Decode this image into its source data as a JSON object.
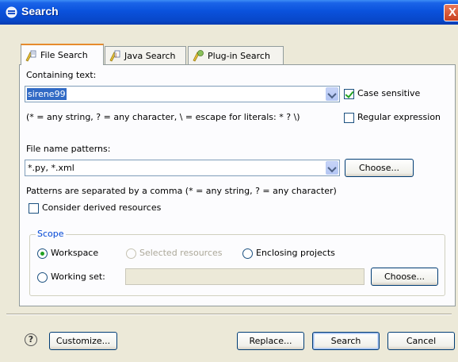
{
  "window": {
    "title": "Search",
    "close_glyph": "X"
  },
  "tabs": [
    {
      "label": "File Search",
      "active": true,
      "icon": "file-search-icon"
    },
    {
      "label": "Java Search",
      "active": false,
      "icon": "java-search-icon"
    },
    {
      "label": "Plug-in Search",
      "active": false,
      "icon": "plugin-search-icon"
    }
  ],
  "containing_text": {
    "label": "Containing text:",
    "value": "sirene99",
    "hint": "(* = any string, ? = any character, \\ = escape for literals: * ? \\)"
  },
  "options": {
    "case_sensitive": {
      "label": "Case sensitive",
      "checked": true
    },
    "regular_expression": {
      "label": "Regular expression",
      "checked": false
    }
  },
  "file_name_patterns": {
    "label": "File name patterns:",
    "value": "*.py, *.xml",
    "choose_label": "Choose...",
    "hint": "Patterns are separated by a comma (* = any string, ? = any character)"
  },
  "consider_derived": {
    "label": "Consider derived resources",
    "checked": false
  },
  "scope": {
    "title": "Scope",
    "workspace": {
      "label": "Workspace",
      "selected": true
    },
    "selected_resources": {
      "label": "Selected resources",
      "selected": false,
      "disabled": true
    },
    "enclosing_projects": {
      "label": "Enclosing projects",
      "selected": false
    },
    "working_set": {
      "label": "Working set:",
      "selected": false,
      "value": ""
    },
    "choose_label": "Choose..."
  },
  "footer": {
    "help_glyph": "?",
    "customize_label": "Customize...",
    "replace_label": "Replace...",
    "search_label": "Search",
    "cancel_label": "Cancel"
  },
  "colors": {
    "titlebar": "#0a52dc",
    "dialog_bg": "#ece9d8",
    "selection": "#316ac5",
    "group_title": "#0046d5",
    "check": "#21a121"
  }
}
